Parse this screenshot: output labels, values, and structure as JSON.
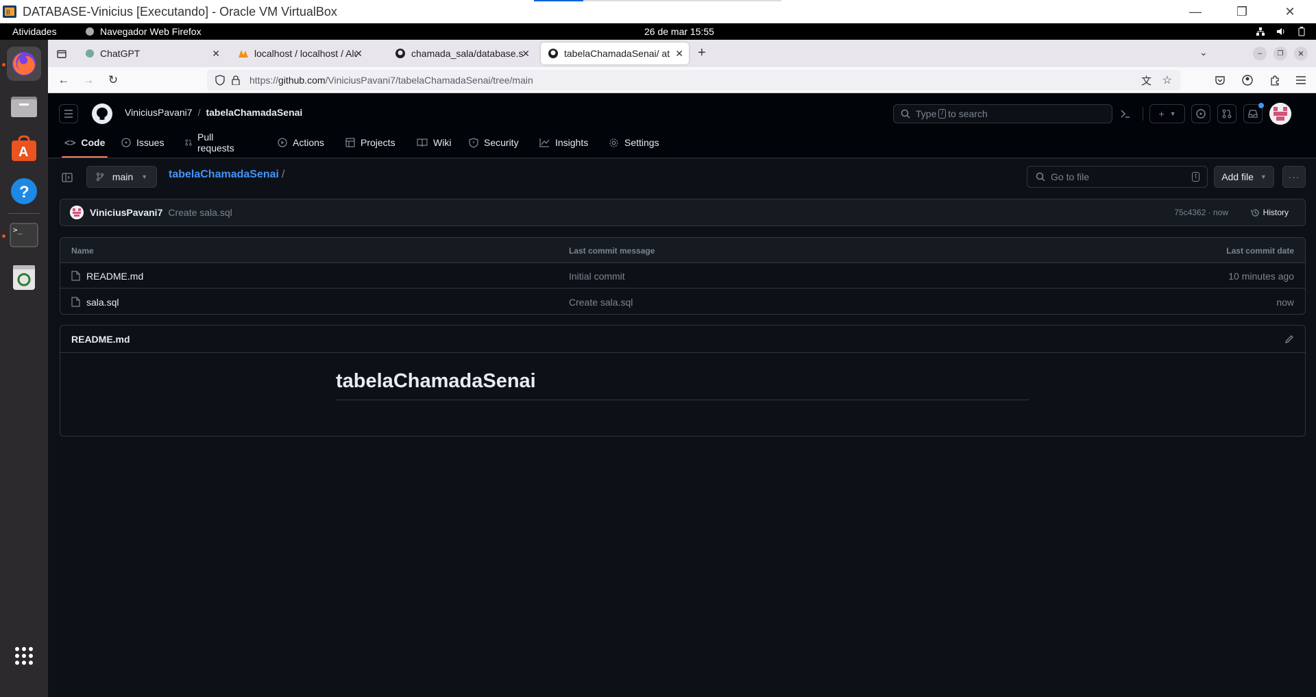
{
  "window": {
    "title": "DATABASE-Vinicius [Executando] - Oracle VM VirtualBox",
    "controls": {
      "minimize": "—",
      "restore": "❐",
      "close": "✕"
    }
  },
  "ubuntu_bar": {
    "activities": "Atividades",
    "app_name": "Navegador Web Firefox",
    "clock": "26 de mar  15:55"
  },
  "browser": {
    "tabs": [
      {
        "label": "ChatGPT"
      },
      {
        "label": "localhost / localhost / Alu"
      },
      {
        "label": "chamada_sala/database.s"
      },
      {
        "label": "tabelaChamadaSenai/ at"
      }
    ],
    "new_tab": "+",
    "url_prefix": "https://",
    "url_host": "github.com",
    "url_path": "/ViniciusPavani7/tabelaChamadaSenai/tree/main"
  },
  "github": {
    "owner": "ViniciusPavani7",
    "repo": "tabelaChamadaSenai",
    "search_prefix": "Type",
    "search_key": "/",
    "search_suffix": "to search",
    "nav": [
      {
        "label": "Code",
        "icon": "code-icon"
      },
      {
        "label": "Issues",
        "icon": "issue-icon"
      },
      {
        "label": "Pull requests",
        "icon": "pull-request-icon"
      },
      {
        "label": "Actions",
        "icon": "play-icon"
      },
      {
        "label": "Projects",
        "icon": "table-icon"
      },
      {
        "label": "Wiki",
        "icon": "book-icon"
      },
      {
        "label": "Security",
        "icon": "shield-icon"
      },
      {
        "label": "Insights",
        "icon": "graph-icon"
      },
      {
        "label": "Settings",
        "icon": "gear-icon"
      }
    ],
    "branch": "main",
    "breadcrumb_repo": "tabelaChamadaSenai",
    "breadcrumb_sep": "/",
    "go_to_file": "Go to file",
    "go_to_file_key": "t",
    "add_file": "Add file",
    "latest_commit": {
      "author": "ViniciusPavani7",
      "message": "Create sala.sql",
      "hash_time": "75c4362 · now",
      "history": "History"
    },
    "files_table": {
      "columns": [
        "Name",
        "Last commit message",
        "Last commit date"
      ],
      "rows": [
        {
          "name": "README.md",
          "message": "Initial commit",
          "date": "10 minutes ago"
        },
        {
          "name": "sala.sql",
          "message": "Create sala.sql",
          "date": "now"
        }
      ]
    },
    "readme": {
      "filename": "README.md",
      "heading": "tabelaChamadaSenai"
    }
  },
  "colors": {
    "page_bg": "#0d1117",
    "header_bg": "#010409",
    "border": "#30363d",
    "link": "#4493f8",
    "accent_underline": "#f78166",
    "ubuntu_orange": "#e95420"
  }
}
